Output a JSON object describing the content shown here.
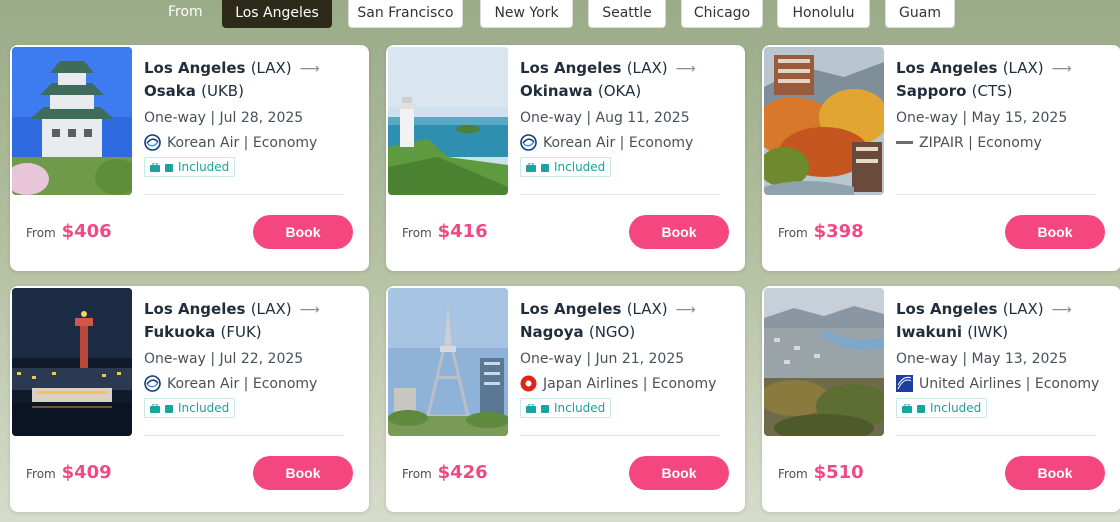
{
  "filter": {
    "from_label": "From",
    "cities": [
      "Los Angeles",
      "San Francisco",
      "New York",
      "Seattle",
      "Chicago",
      "Honolulu",
      "Guam"
    ],
    "active": "Los Angeles"
  },
  "deals": [
    {
      "origin": "Los Angeles",
      "origin_code": "(LAX)",
      "dest": "Osaka",
      "dest_code": "(UKB)",
      "trip": "One-way | Jul 28, 2025",
      "airline": "Korean Air | Economy",
      "airline_logo": "korean-air-logo",
      "included": "Included",
      "from_label": "From",
      "price": "$406",
      "book_label": "Book"
    },
    {
      "origin": "Los Angeles",
      "origin_code": "(LAX)",
      "dest": "Okinawa",
      "dest_code": "(OKA)",
      "trip": "One-way | Aug 11, 2025",
      "airline": "Korean Air | Economy",
      "airline_logo": "korean-air-logo",
      "included": "Included",
      "from_label": "From",
      "price": "$416",
      "book_label": "Book"
    },
    {
      "origin": "Los Angeles",
      "origin_code": "(LAX)",
      "dest": "Sapporo",
      "dest_code": "(CTS)",
      "trip": "One-way | May 15, 2025",
      "airline": "ZIPAIR | Economy",
      "airline_logo": "zipair-logo",
      "included": "",
      "from_label": "From",
      "price": "$398",
      "book_label": "Book"
    },
    {
      "origin": "Los Angeles",
      "origin_code": "(LAX)",
      "dest": "Fukuoka",
      "dest_code": "(FUK)",
      "trip": "One-way | Jul 22, 2025",
      "airline": "Korean Air | Economy",
      "airline_logo": "korean-air-logo",
      "included": "Included",
      "from_label": "From",
      "price": "$409",
      "book_label": "Book"
    },
    {
      "origin": "Los Angeles",
      "origin_code": "(LAX)",
      "dest": "Nagoya",
      "dest_code": "(NGO)",
      "trip": "One-way | Jun 21, 2025",
      "airline": "Japan Airlines | Economy",
      "airline_logo": "japan-airlines-logo",
      "included": "Included",
      "from_label": "From",
      "price": "$426",
      "book_label": "Book"
    },
    {
      "origin": "Los Angeles",
      "origin_code": "(LAX)",
      "dest": "Iwakuni",
      "dest_code": "(IWK)",
      "trip": "One-way | May 13, 2025",
      "airline": "United Airlines | Economy",
      "airline_logo": "united-airlines-logo",
      "included": "Included",
      "from_label": "From",
      "price": "$510",
      "book_label": "Book"
    }
  ],
  "colors": {
    "accent": "#f4477f",
    "price": "#ef4a83",
    "included": "#1aa3a0",
    "active_chip": "#2e2a1a"
  }
}
